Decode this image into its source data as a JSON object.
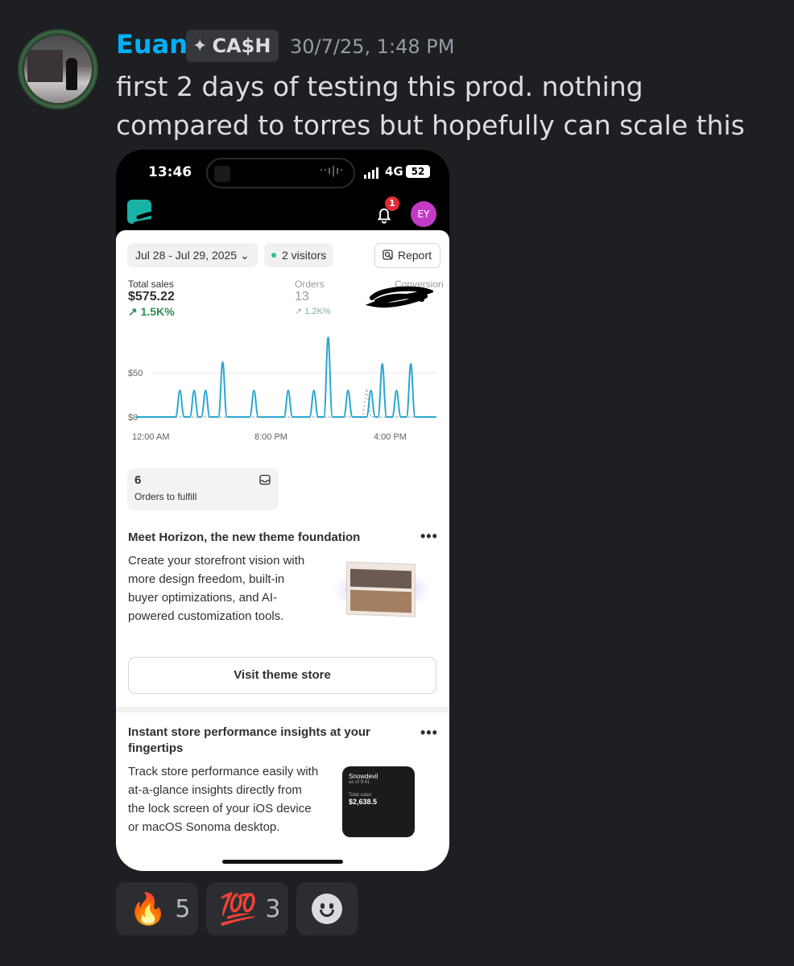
{
  "message": {
    "username": "Euan",
    "role_badge": "CA$H",
    "role_icon": "diamond-sparkle-icon",
    "timestamp": "30/7/25, 1:48 PM",
    "text": "first 2 days of testing this prod. nothing compared to torres but hopefully can scale this"
  },
  "phone": {
    "status_bar": {
      "time": "13:46",
      "network": "4G",
      "battery": "52"
    },
    "header": {
      "notification_count": "1",
      "user_initials": "EY"
    },
    "filters": {
      "date_range": "Jul 28 - Jul 29, 2025 ⌄",
      "visitors": "2 visitors",
      "report": "Report"
    },
    "metrics": [
      {
        "label": "Total sales",
        "value": "$575.22",
        "change": "↗ 1.5K%"
      },
      {
        "label": "Orders",
        "value": "13",
        "change": "↗ 1.2K%"
      },
      {
        "label": "Conversion",
        "value": "",
        "change": ""
      }
    ],
    "chart_data": {
      "type": "line",
      "y_ticks": [
        "$50",
        "$0"
      ],
      "x_ticks": [
        "12:00 AM",
        "8:00 PM",
        "4:00 PM"
      ],
      "ylim": [
        0,
        100
      ],
      "peaks": [
        {
          "x": 0.1,
          "y": 30
        },
        {
          "x": 0.15,
          "y": 30
        },
        {
          "x": 0.19,
          "y": 30
        },
        {
          "x": 0.25,
          "y": 62
        },
        {
          "x": 0.36,
          "y": 30
        },
        {
          "x": 0.48,
          "y": 30
        },
        {
          "x": 0.57,
          "y": 30
        },
        {
          "x": 0.62,
          "y": 90
        },
        {
          "x": 0.69,
          "y": 30
        },
        {
          "x": 0.77,
          "y": 30
        },
        {
          "x": 0.81,
          "y": 60
        },
        {
          "x": 0.86,
          "y": 30
        },
        {
          "x": 0.91,
          "y": 60
        }
      ],
      "comparison_peaks": [
        {
          "x": 0.755,
          "y": 32
        }
      ],
      "color": "#2aa6cf",
      "comparison_color": "#9fb0be"
    },
    "fulfill": {
      "count": "6",
      "label": "Orders to fulfill"
    },
    "horizon_card": {
      "title": "Meet Horizon, the new theme foundation",
      "body": "Create your storefront vision with more design freedom, built-in buyer optimizations, and AI-powered customization tools.",
      "button": "Visit theme store",
      "more": "•••"
    },
    "insights_card": {
      "title": "Instant store performance insights at your fingertips",
      "body": "Track store performance easily with at-a-glance insights directly from the lock screen of your iOS device or macOS Sonoma desktop.",
      "more": "•••",
      "preview": {
        "store": "Snowdevil",
        "as_of": "as of 9:41",
        "label": "Total sales",
        "value": "$2,638.5"
      }
    },
    "tabbar": [
      "search-icon",
      "home-icon",
      "inbox-icon",
      "tag-icon",
      "menu-icon",
      "sidekick-icon"
    ]
  },
  "reactions": [
    {
      "emoji": "🔥",
      "count": "5"
    },
    {
      "emoji": "💯",
      "count": "3"
    }
  ]
}
